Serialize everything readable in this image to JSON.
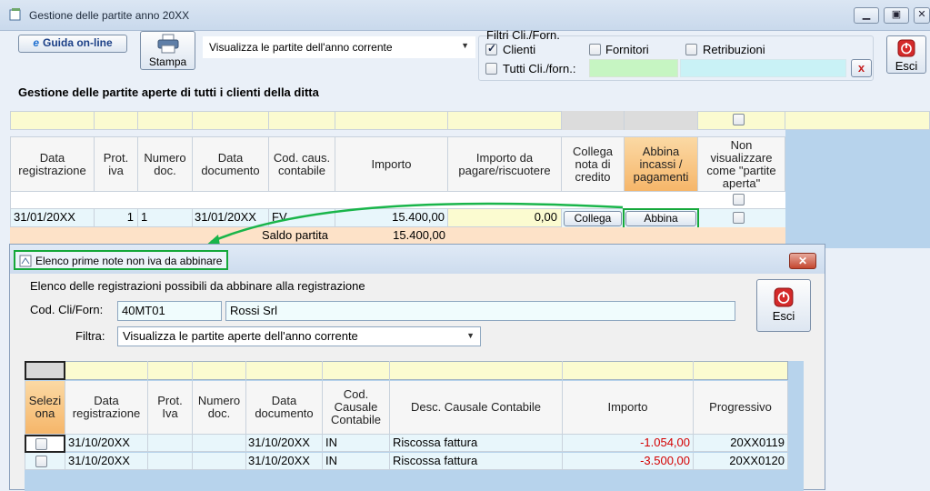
{
  "window": {
    "title": "Gestione delle partite anno 20XX",
    "controls": [
      "▁",
      "▣",
      "✕"
    ]
  },
  "toolbar": {
    "guida_label": "Guida on-line",
    "stampa_label": "Stampa",
    "view_select": "Visualizza le partite dell'anno corrente",
    "esci_label": "Esci"
  },
  "filters": {
    "group_label": "Filtri Cli./Forn.",
    "clienti_label": "Clienti",
    "clienti_checked": true,
    "fornitori_label": "Fornitori",
    "retribuzioni_label": "Retribuzioni",
    "tutti_label": "Tutti Cli./forn.:",
    "clear_label": "x"
  },
  "heading": "Gestione delle partite aperte di tutti i clienti della ditta",
  "main_grid": {
    "headers": [
      "Data registrazione",
      "Prot. iva",
      "Numero doc.",
      "Data documento",
      "Cod. caus. contabile",
      "Importo",
      "Importo da pagare/riscuotere",
      "Collega nota di credito",
      "Abbina incassi / pagamenti",
      "Non visualizzare come \"partite aperta\""
    ],
    "row": {
      "data_reg": "31/01/20XX",
      "prot": "1",
      "numero": "1",
      "data_doc": "31/01/20XX",
      "causale": "FV",
      "importo": "15.400,00",
      "da_pagare": "0,00",
      "collega_label": "Collega",
      "abbina_label": "Abbina"
    },
    "saldo_label": "Saldo partita",
    "saldo_value": "15.400,00"
  },
  "dialog": {
    "title": "Elenco prime note non iva da abbinare",
    "subtitle": "Elenco delle registrazioni possibili da abbinare alla registrazione",
    "cod_label": "Cod. Cli/Forn:",
    "cod_value": "40MT01",
    "name_value": "Rossi Srl",
    "filtra_label": "Filtra:",
    "filtra_value": "Visualizza le partite aperte dell'anno corrente",
    "esci_label": "Esci",
    "headers": [
      "Selezi ona",
      "Data registrazione",
      "Prot. Iva",
      "Numero doc.",
      "Data documento",
      "Cod. Causale Contabile",
      "Desc. Causale Contabile",
      "Importo",
      "Progressivo"
    ],
    "rows": [
      {
        "data_reg": "31/10/20XX",
        "prot": "",
        "numero": "",
        "data_doc": "31/10/20XX",
        "causale": "IN",
        "desc": "Riscossa fattura",
        "importo": "-1.054,00",
        "progressivo": "20XX0119"
      },
      {
        "data_reg": "31/10/20XX",
        "prot": "",
        "numero": "",
        "data_doc": "31/10/20XX",
        "causale": "IN",
        "desc": "Riscossa fattura",
        "importo": "-3.500,00",
        "progressivo": "20XX0120"
      }
    ]
  },
  "colors": {
    "highlight_green": "#15a83a",
    "yellow_row": "#fbfbd0",
    "saldo_row": "#fde2c8",
    "side_panel": "#b7d3ec",
    "negative": "#d40000"
  }
}
